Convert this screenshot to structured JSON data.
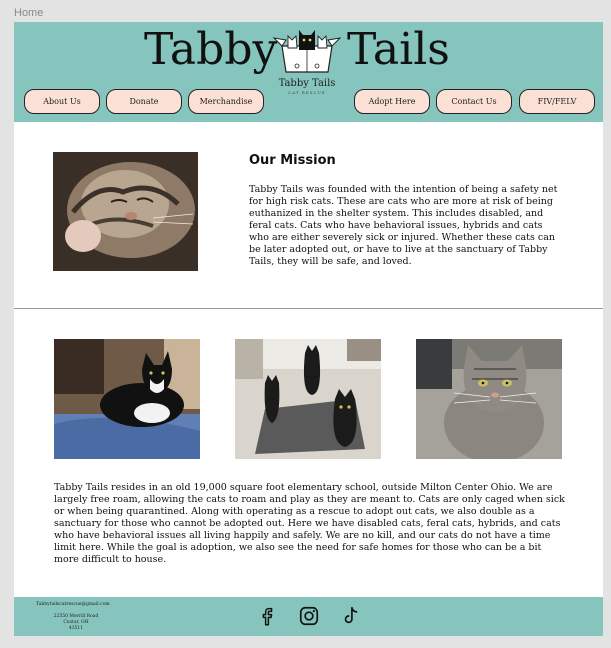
{
  "canvas": {
    "frame_label": "Home"
  },
  "header": {
    "title_left": "Tabby",
    "title_right": "Tails",
    "logo_name": "Tabby Tails",
    "logo_sub": "CAT RESCUE",
    "brand_color": "#86c5be",
    "button_color": "#fbe0d6",
    "nav": [
      {
        "label": "About Us"
      },
      {
        "label": "Donate"
      },
      {
        "label": "Merchandise"
      },
      {
        "label": "Adopt Here"
      },
      {
        "label": "Contact Us"
      },
      {
        "label": "FIV/FELV"
      }
    ]
  },
  "mission": {
    "heading": "Our Mission",
    "text": "Tabby Tails was founded with the intention of being a safety net for high risk cats. These are cats who are more at risk of being euthanized in the shelter system. This includes disabled, and feral cats. Cats who have behavioral issues, hybrids and cats who are either severely sick or injured. Whether these cats can be later adopted out, or have to live at the sanctuary of Tabby Tails, they will be safe, and loved."
  },
  "gallery": {
    "photos": [
      {
        "name": "tuxedo-cat-photo"
      },
      {
        "name": "three-cats-photo"
      },
      {
        "name": "grey-tabby-photo"
      }
    ]
  },
  "about": {
    "text": "Tabby Tails resides in an old 19,000 square foot elementary school, outside Milton Center Ohio. We are largely free roam, allowing the cats to roam and play as they are meant to. Cats are only caged when sick or when being quarantined. Along with operating as a rescue to adopt out cats, we also double as a sanctuary for those who cannot be adopted out. Here we have disabled cats, feral cats, hybrids, and cats who have behavioral issues all living happily and safely. We are no kill, and our cats do not have a time limit here. While the goal is adoption, we also see the need for safe homes for those who can be a bit more difficult to house."
  },
  "footer": {
    "email": "Tabbytailscatrescue@gmail.com",
    "address_line1": "22550 Merrill Road",
    "address_line2": "Custar, OH",
    "address_line3": "43511",
    "social": [
      "facebook-icon",
      "instagram-icon",
      "tiktok-icon"
    ]
  }
}
